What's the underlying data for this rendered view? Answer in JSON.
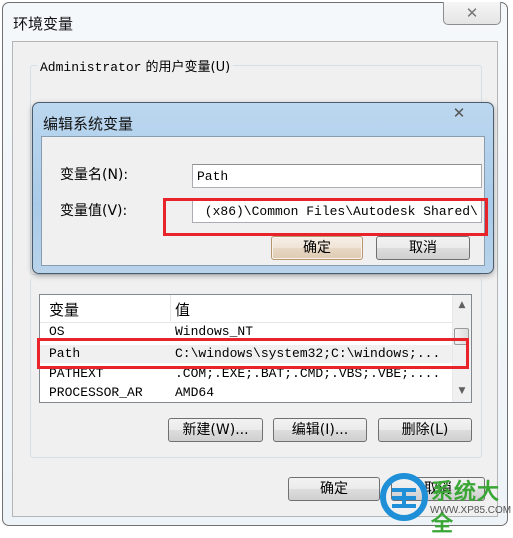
{
  "outer_window": {
    "title": "环境变量",
    "close_glyph": "✕",
    "user_group_label_user": "Administrator",
    "user_group_label_suffix": " 的用户变量(U)"
  },
  "edit_dialog": {
    "title": "编辑系统变量",
    "close_glyph": "✕",
    "name_label": "变量名(N):",
    "name_value": "Path",
    "value_label": "变量值(V):",
    "value_value": " (x86)\\Common Files\\Autodesk Shared\\",
    "ok_label": "确定",
    "cancel_label": "取消"
  },
  "system_vars": {
    "columns": [
      "变量",
      "值"
    ],
    "rows": [
      {
        "name": "OS",
        "value": "Windows_NT"
      },
      {
        "name": "Path",
        "value": "C:\\windows\\system32;C:\\windows;..."
      },
      {
        "name": "PATHEXT",
        "value": ".COM;.EXE;.BAT;.CMD;.VBS;.VBE;...."
      },
      {
        "name": "PROCESSOR_AR",
        "value": "AMD64"
      }
    ],
    "selected_index": 1,
    "new_label": "新建(W)...",
    "edit_label": "编辑(I)...",
    "delete_label": "删除(L)"
  },
  "footer": {
    "ok_label": "确定",
    "cancel_label": "取消"
  },
  "watermark": {
    "text": "系统大全",
    "url": "WWW.XP85.COM",
    "colors": {
      "logo": "#1f8fd8",
      "text": "#3aa635"
    }
  },
  "highlight_color": "#e8242a"
}
